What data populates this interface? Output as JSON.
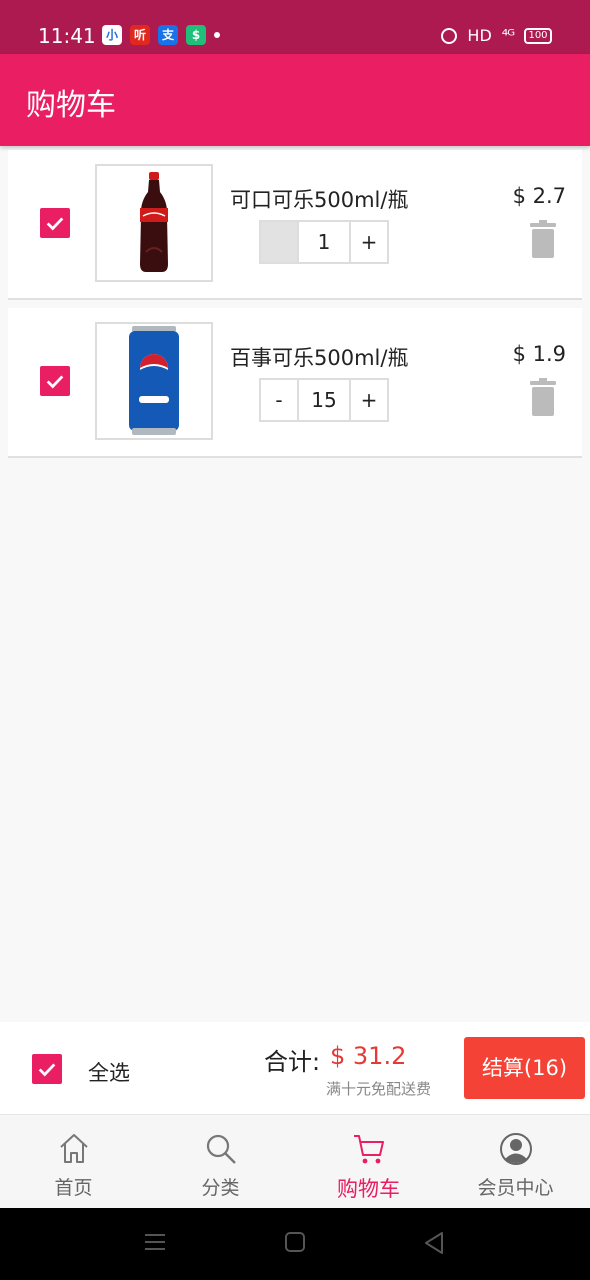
{
  "status_bar": {
    "time": "11:41",
    "app_icons": [
      "小",
      "听",
      "支",
      "$"
    ],
    "network": "HD",
    "signal": "⁴ᴳ",
    "battery": "100"
  },
  "app_bar": {
    "title": "购物车"
  },
  "cart": {
    "items": [
      {
        "name": "可口可乐500ml/瓶",
        "price": "$ 2.7",
        "qty": "1",
        "minus": "",
        "plus": "+",
        "checked": true
      },
      {
        "name": "百事可乐500ml/瓶",
        "price": "$ 1.9",
        "qty": "15",
        "minus": "-",
        "plus": "+",
        "checked": true
      }
    ]
  },
  "checkout": {
    "select_all_label": "全选",
    "total_label": "合计:",
    "total_amount": "$ 31.2",
    "delivery_note": "满十元免配送费",
    "checkout_button": "结算(16)"
  },
  "bottom_nav": {
    "items": [
      {
        "label": "首页",
        "icon": "home-icon"
      },
      {
        "label": "分类",
        "icon": "search-icon"
      },
      {
        "label": "购物车",
        "icon": "cart-icon",
        "active": true
      },
      {
        "label": "会员中心",
        "icon": "user-icon"
      }
    ]
  },
  "colors": {
    "primary": "#e91e63",
    "status_bar": "#ad1a4f",
    "price_red": "#e53935",
    "checkout_button": "#f44336"
  }
}
